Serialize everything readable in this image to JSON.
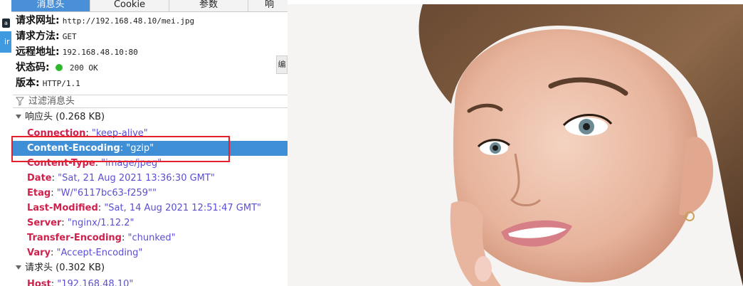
{
  "tabs": [
    {
      "label": "消息头",
      "active": true
    },
    {
      "label": "Cookie",
      "active": false
    },
    {
      "label": "参数",
      "active": false
    },
    {
      "label": "响",
      "active": false
    }
  ],
  "strip": {
    "mark": "a",
    "tab_text": "ir"
  },
  "request_info": {
    "url_label": "请求网址:",
    "url_value": "http://192.168.48.10/mei.jpg",
    "method_label": "请求方法:",
    "method_value": "GET",
    "remote_label": "远程地址:",
    "remote_value": "192.168.48.10:80",
    "status_label": "状态码:",
    "status_value": "200 OK",
    "version_label": "版本:",
    "version_value": "HTTP/1.1",
    "side_button": "编"
  },
  "filter": {
    "placeholder": "过滤消息头"
  },
  "response_section": {
    "title": "响应头 (0.268 KB)"
  },
  "response_headers": [
    {
      "name": "Connection",
      "value": "\"keep-alive\"",
      "selected": false
    },
    {
      "name": "Content-Encoding",
      "value": "\"gzip\"",
      "selected": true
    },
    {
      "name": "Content-Type",
      "value": "\"image/jpeg\"",
      "selected": false
    },
    {
      "name": "Date",
      "value": "\"Sat, 21 Aug 2021 13:36:30 GMT\"",
      "selected": false
    },
    {
      "name": "Etag",
      "value": "\"W/\"6117bc63-f259\"\"",
      "selected": false
    },
    {
      "name": "Last-Modified",
      "value": "\"Sat, 14 Aug 2021 12:51:47 GMT\"",
      "selected": false
    },
    {
      "name": "Server",
      "value": "\"nginx/1.12.2\"",
      "selected": false
    },
    {
      "name": "Transfer-Encoding",
      "value": "\"chunked\"",
      "selected": false
    },
    {
      "name": "Vary",
      "value": "\"Accept-Encoding\"",
      "selected": false
    }
  ],
  "request_section": {
    "title": "请求头 (0.302 KB)"
  },
  "request_headers": [
    {
      "name": "Host",
      "value": "\"192.168.48.10\"",
      "selected": false
    }
  ],
  "colors": {
    "accent": "#3f8fd6",
    "header_name": "#d0214d",
    "header_value": "#5a4fd4",
    "status_ok": "#2eb82e",
    "highlight": "#e3202c"
  }
}
